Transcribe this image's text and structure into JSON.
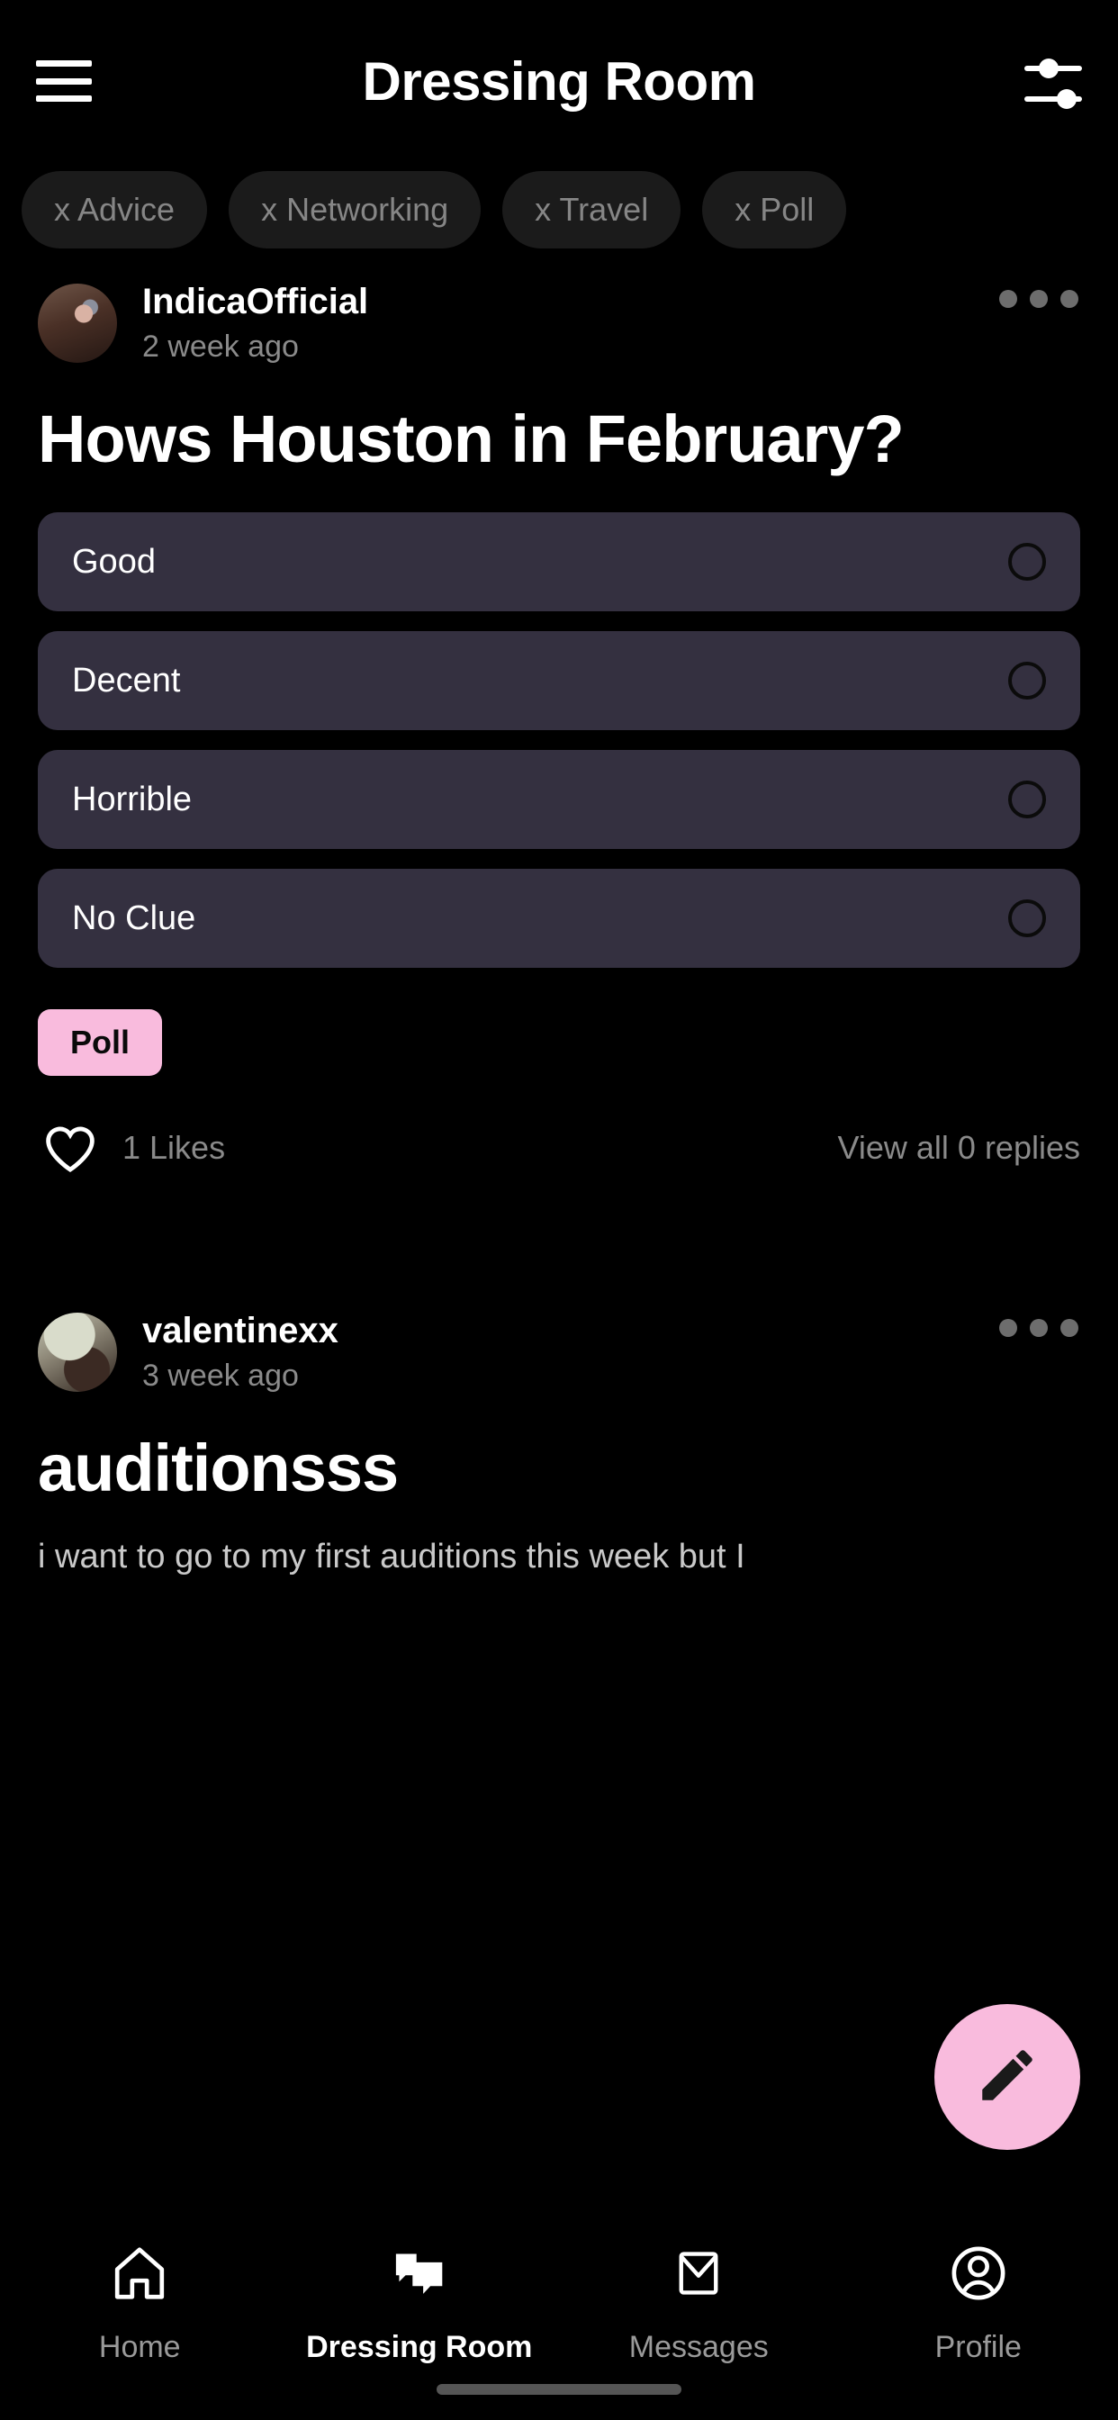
{
  "header": {
    "title": "Dressing Room",
    "menu_icon": "hamburger-menu-icon",
    "filter_icon": "sliders-filter-icon"
  },
  "filter_chips": [
    {
      "label": "x Advice"
    },
    {
      "label": "x Networking"
    },
    {
      "label": "x Travel"
    },
    {
      "label": "x Poll"
    }
  ],
  "posts": [
    {
      "username": "IndicaOfficial",
      "timestamp": "2 week ago",
      "title": "Hows Houston in February?",
      "poll_options": [
        {
          "label": "Good"
        },
        {
          "label": "Decent"
        },
        {
          "label": "Horrible"
        },
        {
          "label": "No Clue"
        }
      ],
      "tag": "Poll",
      "likes": "1 Likes",
      "replies": "View all 0 replies"
    },
    {
      "username": "valentinexx",
      "timestamp": "3 week ago",
      "title": "auditionsss",
      "body": "i want to go to my first auditions this week but I"
    }
  ],
  "fab": {
    "icon": "pencil-edit-icon",
    "color": "#F9BBDD"
  },
  "bottom_nav": [
    {
      "label": "Home",
      "icon": "home-icon",
      "active": false
    },
    {
      "label": "Dressing Room",
      "icon": "chat-bubbles-icon",
      "active": true
    },
    {
      "label": "Messages",
      "icon": "envelope-icon",
      "active": false
    },
    {
      "label": "Profile",
      "icon": "person-circle-icon",
      "active": false
    }
  ],
  "colors": {
    "background": "#000000",
    "poll_option_bg": "#343040",
    "accent_pink": "#F9BBDD",
    "chip_bg": "#1B1B1B",
    "muted_text": "#8A8A8A"
  }
}
